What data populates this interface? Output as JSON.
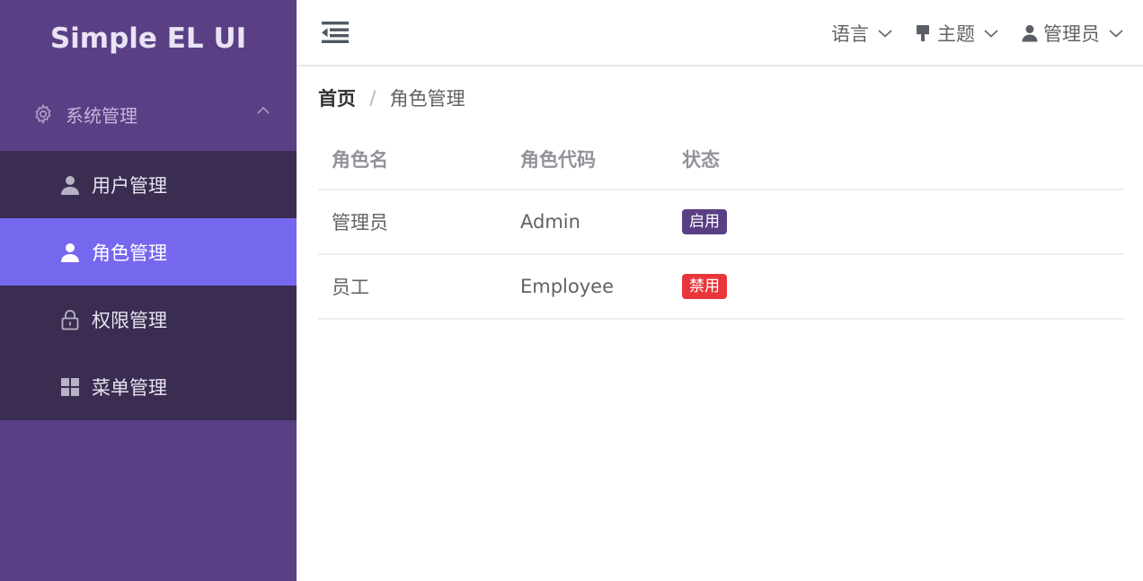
{
  "colors": {
    "sidebar_bg": "#5a3f85",
    "submenu_bg": "#3b2c51",
    "active_item_bg": "#7568ee",
    "badge_enabled": "#5a3f85",
    "badge_disabled": "#e8363b"
  },
  "sidebar": {
    "logo": "Simple EL UI",
    "submenu": {
      "label": "系统管理",
      "icon": "gear-icon",
      "expanded": true
    },
    "items": [
      {
        "label": "用户管理",
        "icon": "user-icon",
        "active": false
      },
      {
        "label": "角色管理",
        "icon": "user-icon",
        "active": true
      },
      {
        "label": "权限管理",
        "icon": "lock-icon",
        "active": false
      },
      {
        "label": "菜单管理",
        "icon": "grid-icon",
        "active": false
      }
    ]
  },
  "header": {
    "collapse_icon": "menu-fold-icon",
    "language": "语言",
    "theme": "主题",
    "user": "管理员"
  },
  "breadcrumb": {
    "home": "首页",
    "separator": "/",
    "current": "角色管理"
  },
  "table": {
    "columns": [
      "角色名",
      "角色代码",
      "状态"
    ],
    "rows": [
      {
        "name": "管理员",
        "code": "Admin",
        "status": "启用",
        "status_type": "enabled"
      },
      {
        "name": "员工",
        "code": "Employee",
        "status": "禁用",
        "status_type": "disabled"
      }
    ]
  }
}
